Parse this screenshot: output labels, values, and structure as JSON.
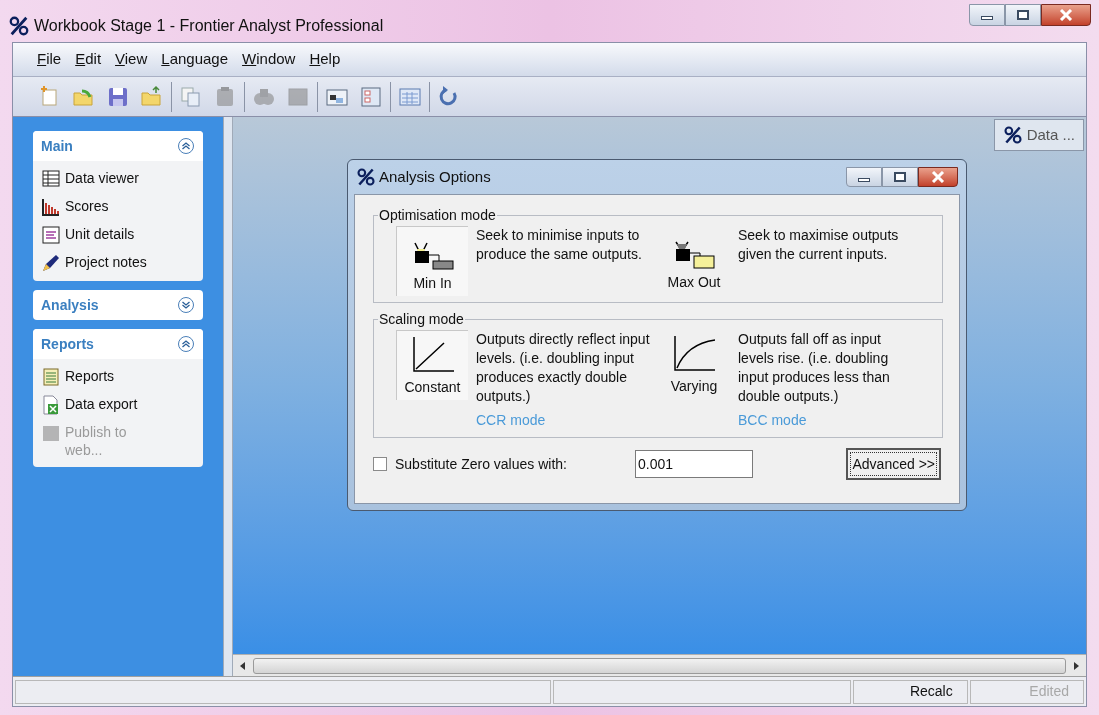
{
  "window": {
    "title": "Workbook Stage 1 - Frontier Analyst Professional"
  },
  "menu": [
    "File",
    "Edit",
    "View",
    "Language",
    "Window",
    "Help"
  ],
  "toolbar": [
    [
      {
        "kind": "new",
        "disabled": false
      },
      {
        "kind": "open",
        "disabled": false
      },
      {
        "kind": "save",
        "disabled": false
      },
      {
        "kind": "folder",
        "disabled": false
      }
    ],
    [
      {
        "kind": "copy",
        "disabled": false
      },
      {
        "kind": "paste",
        "disabled": true
      }
    ],
    [
      {
        "kind": "find",
        "disabled": true
      },
      {
        "kind": "grid",
        "disabled": true
      }
    ],
    [
      {
        "kind": "window",
        "disabled": false
      },
      {
        "kind": "form",
        "disabled": false
      }
    ],
    [
      {
        "kind": "table",
        "disabled": false
      }
    ],
    [
      {
        "kind": "refresh",
        "disabled": false
      }
    ]
  ],
  "sidebar": [
    {
      "title": "Main",
      "expanded": true,
      "items": [
        {
          "kind": "table",
          "label": "Data viewer",
          "disabled": false
        },
        {
          "kind": "bars",
          "label": "Scores",
          "disabled": false
        },
        {
          "kind": "doc",
          "label": "Unit details",
          "disabled": false
        },
        {
          "kind": "pen",
          "label": "Project notes",
          "disabled": false
        }
      ]
    },
    {
      "title": "Analysis",
      "expanded": false
    },
    {
      "title": "Reports",
      "expanded": true,
      "items": [
        {
          "kind": "report",
          "label": "Reports",
          "disabled": false
        },
        {
          "kind": "sheet",
          "label": "Data export",
          "disabled": false
        },
        {
          "kind": "web",
          "label": "Publish to web...",
          "disabled": true
        }
      ]
    }
  ],
  "mdi_tab": {
    "label": "Data ..."
  },
  "dialog": {
    "title": "Analysis Options",
    "groups": [
      {
        "title": "Optimisation mode",
        "options": [
          {
            "kind": "min-in",
            "label": "Min In",
            "description": "Seek to minimise inputs to produce the same outputs.",
            "selected": true
          },
          {
            "kind": "max-out",
            "label": "Max Out",
            "description": "Seek to maximise outputs given the current inputs.",
            "selected": false
          }
        ]
      },
      {
        "title": "Scaling mode",
        "options": [
          {
            "kind": "constant",
            "label": "Constant",
            "description": "Outputs directly reflect input levels. (i.e. doubling input produces exactly double outputs.)",
            "link": "CCR mode",
            "selected": true
          },
          {
            "kind": "varying",
            "label": "Varying",
            "description": "Outputs fall off as input levels rise. (i.e. doubling input produces less than double outputs.)",
            "link": "BCC mode",
            "selected": false
          }
        ]
      }
    ],
    "substitute": {
      "label": "Substitute Zero values with:",
      "checked": false,
      "value": "0.001"
    },
    "advanced_button": "Advanced >>"
  },
  "status_bar": [
    {
      "text": "Recalc",
      "disabled": false
    },
    {
      "text": "Edited",
      "disabled": true
    }
  ]
}
